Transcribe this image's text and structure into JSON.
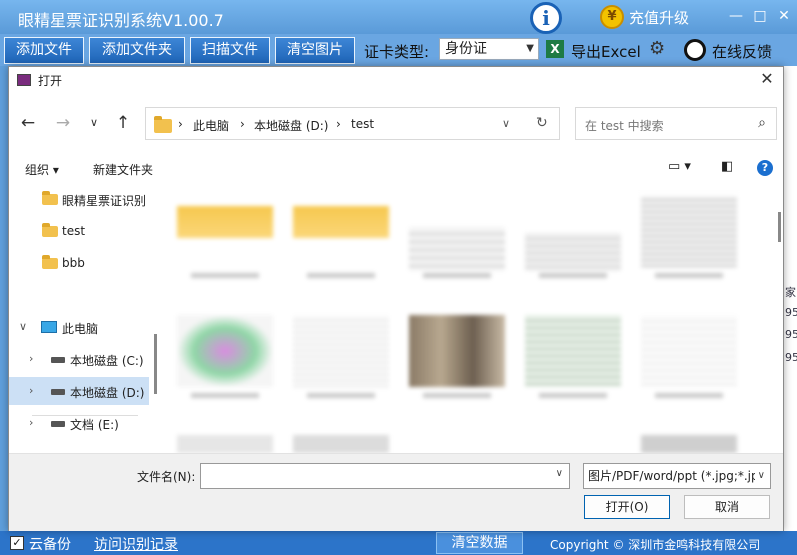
{
  "app": {
    "title": "眼精星票证识别系统V1.00.7",
    "recharge_label": "充值升级",
    "minimize": "—",
    "maximize": "□",
    "close": "✕"
  },
  "toolbar": {
    "add_file": "添加文件",
    "add_folder": "添加文件夹",
    "scan": "扫描文件",
    "clear_images": "清空图片",
    "cert_type_label": "证卡类型:",
    "cert_type_value": "身份证",
    "export_excel": "导出Excel",
    "feedback": "在线反馈"
  },
  "right_strip": [
    "家",
    "95",
    "95",
    "95"
  ],
  "dialog": {
    "title": "打开",
    "breadcrumb": [
      "此电脑",
      "本地磁盘 (D:)",
      "test"
    ],
    "search_placeholder": "在 test 中搜索",
    "organize": "组织",
    "new_folder": "新建文件夹",
    "nav": {
      "quick_access": [
        "眼精星票证识别",
        "test",
        "bbb"
      ],
      "this_pc": "此电脑",
      "drives": [
        {
          "label": "本地磁盘 (C:)",
          "selected": false
        },
        {
          "label": "本地磁盘 (D:)",
          "selected": true
        },
        {
          "label": "文档 (E:)",
          "selected": false
        }
      ]
    },
    "filename_label": "文件名(N):",
    "filename_value": "",
    "filetype": "图片/PDF/word/ppt (*.jpg;*.jp",
    "open_button": "打开(O)",
    "cancel_button": "取消"
  },
  "footer": {
    "cloud_backup": "云备份",
    "history_link": "访问识别记录",
    "clear_data": "清空数据",
    "copyright": "Copyright © 深圳市金鸣科技有限公司"
  },
  "colors": {
    "title_bar": "#5a9ad8",
    "toolbar_button": "#1f65b8",
    "status_bar": "#2c74c9",
    "selection": "#cce0f5"
  }
}
